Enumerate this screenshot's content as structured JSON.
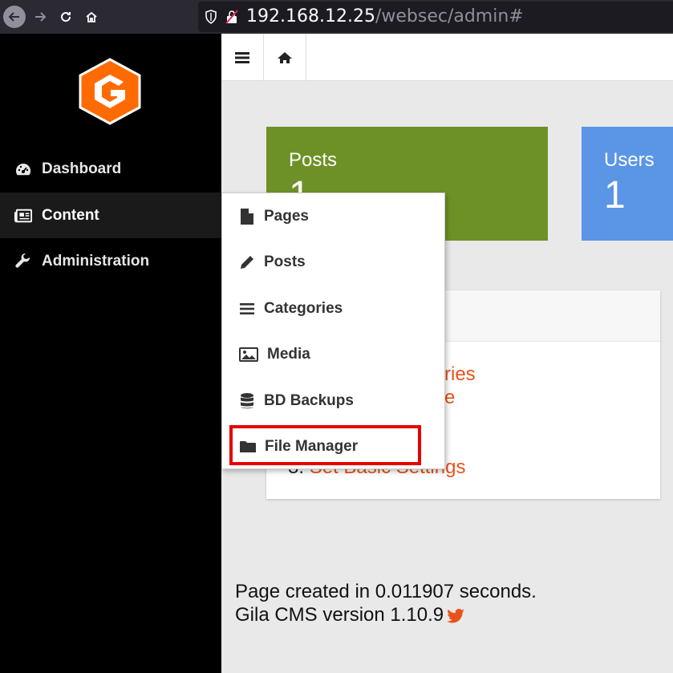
{
  "browser": {
    "url_host": "192.168.12.25",
    "url_path": "/websec/admin#"
  },
  "sidebar": {
    "items": [
      {
        "label": "Dashboard",
        "icon": "dashboard-icon"
      },
      {
        "label": "Content",
        "icon": "newspaper-icon",
        "active": true
      },
      {
        "label": "Administration",
        "icon": "wrench-icon"
      }
    ]
  },
  "toolbar": {
    "menu_icon": "hamburger-icon",
    "home_icon": "home-icon"
  },
  "cards": {
    "posts": {
      "title": "Posts",
      "value": "1",
      "color": "#6e9127"
    },
    "users": {
      "title": "Users",
      "value": "1",
      "color": "#5b95e6"
    }
  },
  "panel": {
    "lines": [
      {
        "num": "",
        "text": "ries"
      },
      {
        "num": "",
        "text": "e"
      },
      {
        "num": "3.",
        "text": "Set Basic Settings"
      }
    ]
  },
  "dropdown": {
    "items": [
      {
        "label": "Pages",
        "icon": "file-icon"
      },
      {
        "label": "Posts",
        "icon": "pencil-icon"
      },
      {
        "label": "Categories",
        "icon": "list-icon"
      },
      {
        "label": "Media",
        "icon": "image-icon"
      },
      {
        "label": "BD Backups",
        "icon": "database-icon"
      },
      {
        "label": "File Manager",
        "icon": "folder-icon",
        "highlighted": true
      }
    ]
  },
  "footer": {
    "created": "Page created in 0.011907 seconds.",
    "version": "Gila CMS version 1.10.9"
  },
  "colors": {
    "accent": "#e8531b",
    "highlight": "#e60000",
    "sidebar_bg": "#000000"
  }
}
